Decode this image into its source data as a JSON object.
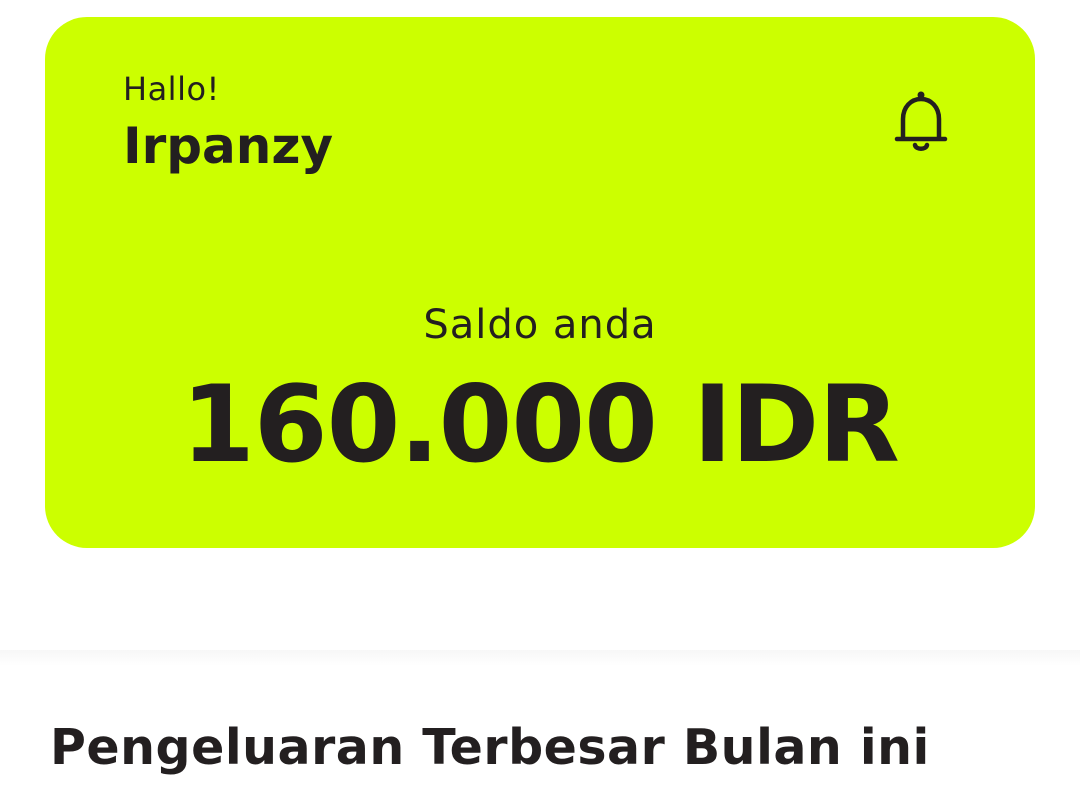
{
  "card": {
    "greeting": "Hallo!",
    "username": "Irpanzy",
    "notification_icon": "bell-icon",
    "balance_label": "Saldo anda",
    "balance_value": "160.000 IDR",
    "background_color": "#ccff00"
  },
  "section": {
    "title": "Pengeluaran Terbesar Bulan ini"
  }
}
